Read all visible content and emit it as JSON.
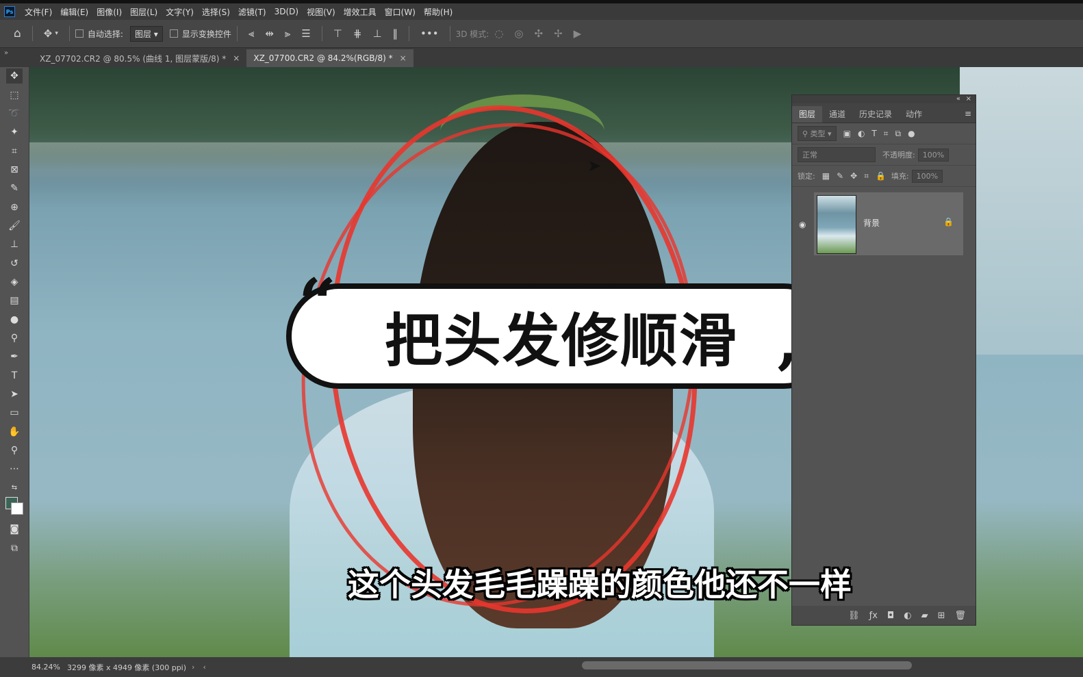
{
  "app": {
    "logo": "Ps"
  },
  "menu": [
    "文件(F)",
    "编辑(E)",
    "图像(I)",
    "图层(L)",
    "文字(Y)",
    "选择(S)",
    "滤镜(T)",
    "3D(D)",
    "视图(V)",
    "增效工具",
    "窗口(W)",
    "帮助(H)"
  ],
  "options": {
    "auto_select_label": "自动选择:",
    "auto_select_value": "图层",
    "show_transform_label": "显示变换控件",
    "mode3d_label": "3D 模式:",
    "more": "•••"
  },
  "tabs": [
    {
      "label": "XZ_07702.CR2 @ 80.5% (曲线 1, 图层蒙版/8) *",
      "close": "×"
    },
    {
      "label": "XZ_07700.CR2 @ 84.2%(RGB/8) *",
      "close": "×"
    }
  ],
  "overlay": {
    "title": "把头发修顺滑",
    "quote_open": "“",
    "quote_close": "”",
    "subtitle": "这个头发毛毛躁躁的颜色他还不一样"
  },
  "panel": {
    "tabs": [
      "图层",
      "通道",
      "历史记录",
      "动作"
    ],
    "filter_placeholder": "类型",
    "blend_mode": "正常",
    "opacity_label": "不透明度:",
    "opacity_value": "100%",
    "lock_label": "锁定:",
    "fill_label": "填充:",
    "fill_value": "100%",
    "layer_name": "背景"
  },
  "status": {
    "zoom": "84.24%",
    "doc_info": "3299 像素 x 4949 像素 (300 ppi)"
  },
  "colors": {
    "foreground": "#3b6457",
    "background": "#ffffff",
    "annotation": "#e8362d"
  }
}
